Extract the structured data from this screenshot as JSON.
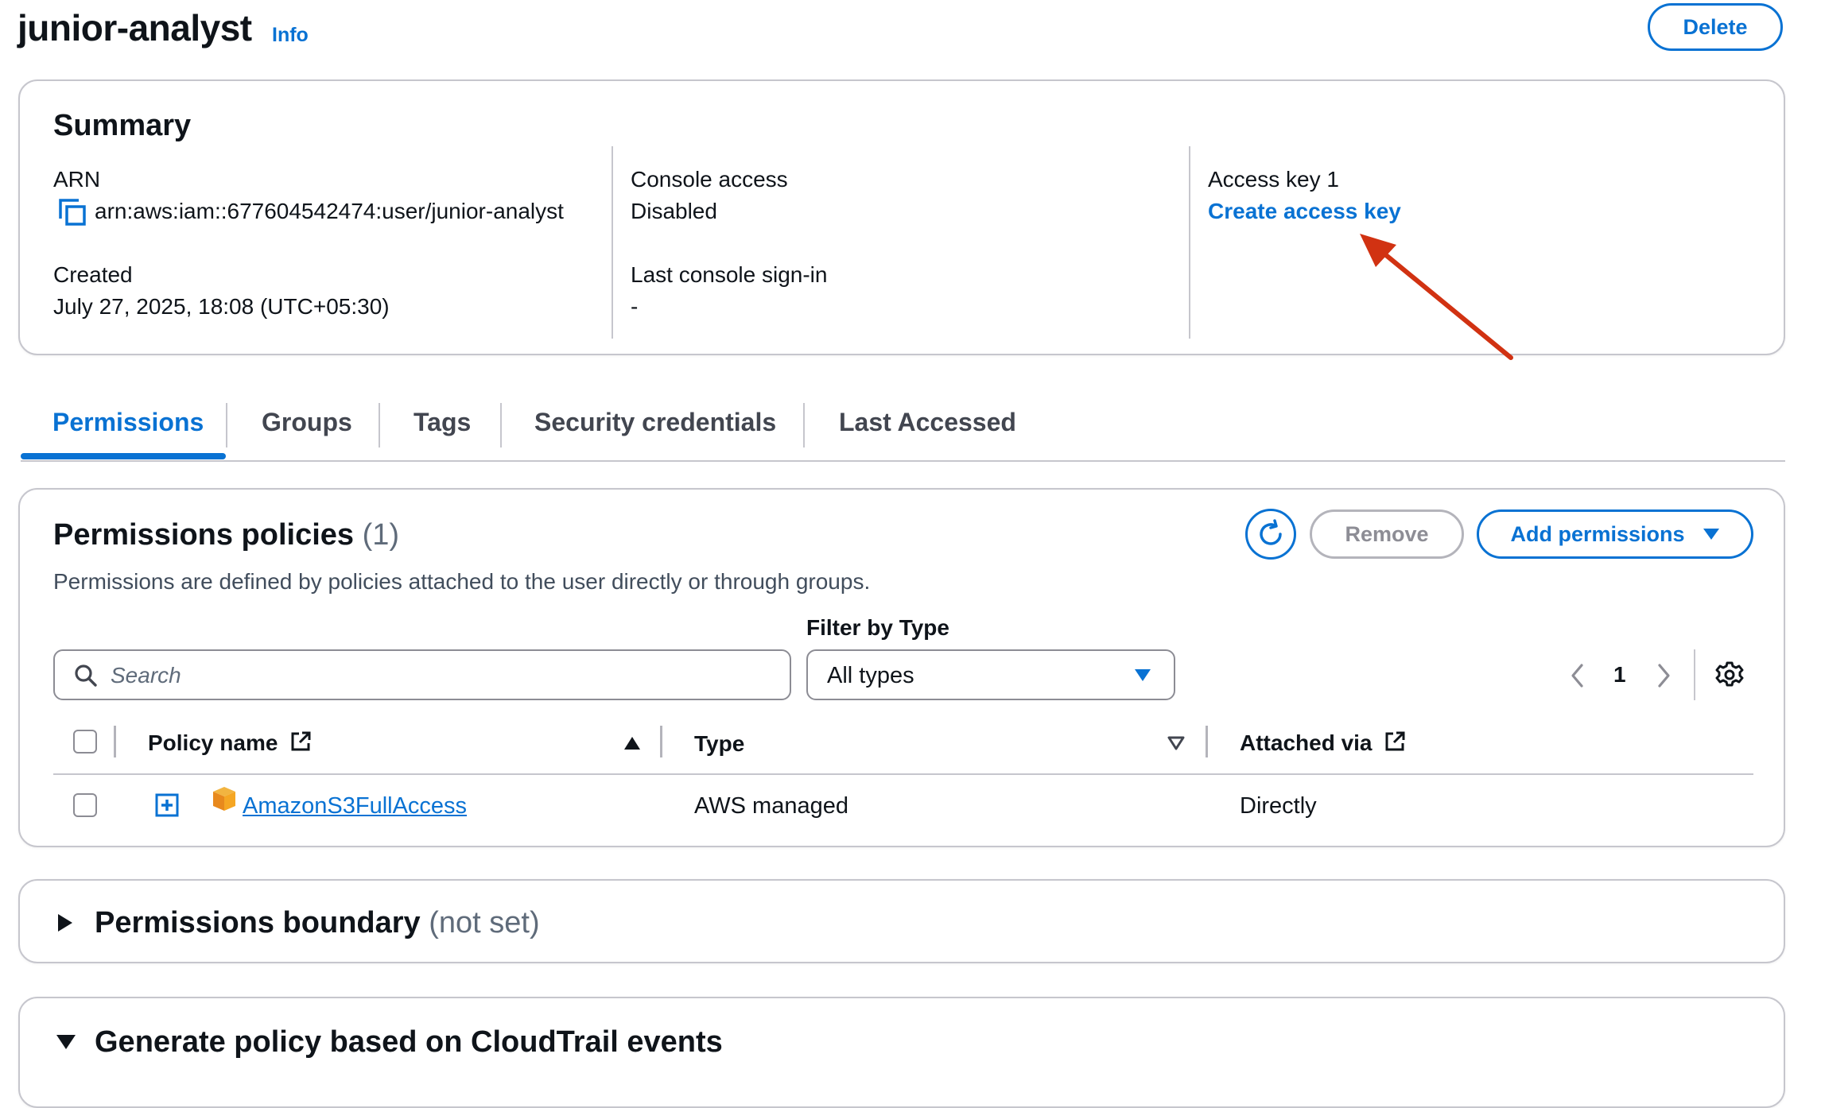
{
  "header": {
    "title": "junior-analyst",
    "info_label": "Info",
    "delete_label": "Delete"
  },
  "summary": {
    "title": "Summary",
    "arn_label": "ARN",
    "arn_value": "arn:aws:iam::677604542474:user/junior-analyst",
    "created_label": "Created",
    "created_value": "July 27, 2025, 18:08 (UTC+05:30)",
    "console_access_label": "Console access",
    "console_access_value": "Disabled",
    "last_signin_label": "Last console sign-in",
    "last_signin_value": "-",
    "access_key_label": "Access key 1",
    "create_access_key_label": "Create access key"
  },
  "tabs": [
    {
      "label": "Permissions",
      "active": true
    },
    {
      "label": "Groups"
    },
    {
      "label": "Tags"
    },
    {
      "label": "Security credentials"
    },
    {
      "label": "Last Accessed"
    }
  ],
  "permissions": {
    "title": "Permissions policies",
    "count": "(1)",
    "description": "Permissions are defined by policies attached to the user directly or through groups.",
    "remove_label": "Remove",
    "add_label": "Add permissions",
    "search_placeholder": "Search",
    "filter_label": "Filter by Type",
    "filter_value": "All types",
    "page": "1",
    "columns": {
      "policy_name": "Policy name",
      "type": "Type",
      "attached_via": "Attached via"
    },
    "rows": [
      {
        "policy_name": "AmazonS3FullAccess",
        "type": "AWS managed",
        "attached_via": "Directly"
      }
    ]
  },
  "boundary": {
    "title": "Permissions boundary",
    "status": "(not set)"
  },
  "cloudtrail": {
    "title": "Generate policy based on CloudTrail events"
  },
  "colors": {
    "accent": "#0972d3",
    "annotation_arrow": "#d13212",
    "border": "#c6c6cd"
  }
}
